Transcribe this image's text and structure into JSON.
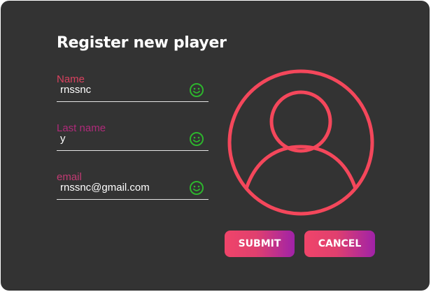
{
  "form": {
    "title": "Register new player",
    "fields": [
      {
        "label": "Name",
        "value": "rnssnc",
        "label_color": "#d9415f",
        "status_icon": "smiley-icon"
      },
      {
        "label": "Last name",
        "value": "y",
        "label_color": "#b02a7a",
        "status_icon": "smiley-icon"
      },
      {
        "label": "email",
        "value": "rnssnc@gmail.com",
        "label_color": "#c23a73",
        "status_icon": "smiley-icon"
      }
    ],
    "submit_label": "SUBMIT",
    "cancel_label": "CANCEL"
  },
  "avatar": {
    "icon": "user-avatar-icon",
    "color": "#f4475b"
  },
  "colors": {
    "background": "#333333",
    "valid_icon": "#2db52d",
    "button_gradient_start": "#f0446a",
    "button_gradient_end": "#a022a8"
  }
}
